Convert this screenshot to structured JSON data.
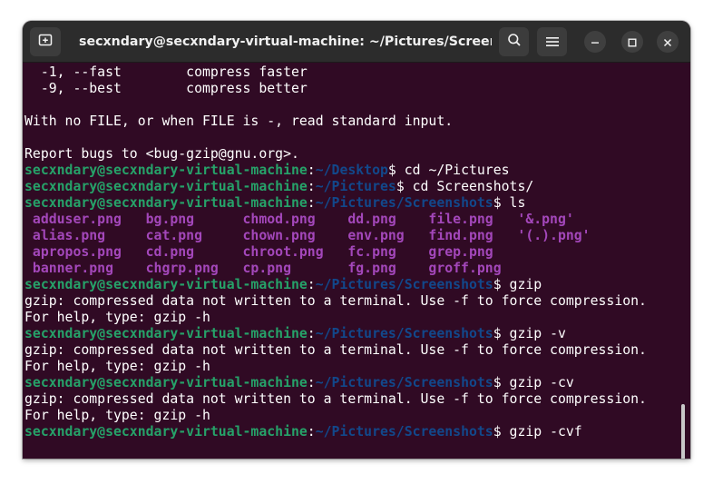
{
  "window": {
    "title": "secxndary@secxndary-virtual-machine: ~/Pictures/Screensh..."
  },
  "icons": {
    "new_tab": "new-tab-icon",
    "search": "search-icon",
    "menu": "hamburger-menu-icon",
    "minimize": "minimize-icon",
    "maximize": "maximize-icon",
    "close": "close-icon"
  },
  "colors": {
    "background": "#300a24",
    "titlebar": "#2c2c2c",
    "user_host": "#26a269",
    "path": "#12488b",
    "image_files": "#a347ba",
    "text": "#ffffff"
  },
  "terminal": {
    "lines": [
      {
        "segments": [
          {
            "text": "  -1, --fast        compress faster",
            "cls": "w"
          }
        ]
      },
      {
        "segments": [
          {
            "text": "  -9, --best        compress better",
            "cls": "w"
          }
        ]
      },
      {
        "segments": [
          {
            "text": "",
            "cls": "w"
          }
        ]
      },
      {
        "segments": [
          {
            "text": "With no FILE, or when FILE is -, read standard input.",
            "cls": "w"
          }
        ]
      },
      {
        "segments": [
          {
            "text": "",
            "cls": "w"
          }
        ]
      },
      {
        "segments": [
          {
            "text": "Report bugs to <bug-gzip@gnu.org>.",
            "cls": "w"
          }
        ]
      },
      {
        "segments": [
          {
            "text": "secxndary@secxndary-virtual-machine",
            "cls": "g"
          },
          {
            "text": ":",
            "cls": "w"
          },
          {
            "text": "~/Desktop",
            "cls": "b"
          },
          {
            "text": "$ cd ~/Pictures",
            "cls": "w"
          }
        ]
      },
      {
        "segments": [
          {
            "text": "secxndary@secxndary-virtual-machine",
            "cls": "g"
          },
          {
            "text": ":",
            "cls": "w"
          },
          {
            "text": "~/Pictures",
            "cls": "b"
          },
          {
            "text": "$ cd Screenshots/",
            "cls": "w"
          }
        ]
      },
      {
        "segments": [
          {
            "text": "secxndary@secxndary-virtual-machine",
            "cls": "g"
          },
          {
            "text": ":",
            "cls": "w"
          },
          {
            "text": "~/Pictures/Screenshots",
            "cls": "b"
          },
          {
            "text": "$ ls",
            "cls": "w"
          }
        ]
      },
      {
        "segments": [
          {
            "text": " adduser.png   bg.png      chmod.png    dd.png    file.png   '&.png'",
            "cls": "m"
          }
        ]
      },
      {
        "segments": [
          {
            "text": " alias.png     cat.png     chown.png    env.png   find.png   '(.).png'",
            "cls": "m"
          }
        ]
      },
      {
        "segments": [
          {
            "text": " apropos.png   cd.png      chroot.png   fc.png    grep.png",
            "cls": "m"
          }
        ]
      },
      {
        "segments": [
          {
            "text": " banner.png    chgrp.png   cp.png       fg.png    groff.png",
            "cls": "m"
          }
        ]
      },
      {
        "segments": [
          {
            "text": "secxndary@secxndary-virtual-machine",
            "cls": "g"
          },
          {
            "text": ":",
            "cls": "w"
          },
          {
            "text": "~/Pictures/Screenshots",
            "cls": "b"
          },
          {
            "text": "$ gzip",
            "cls": "w"
          }
        ]
      },
      {
        "segments": [
          {
            "text": "gzip: compressed data not written to a terminal. Use -f to force compression.",
            "cls": "w"
          }
        ]
      },
      {
        "segments": [
          {
            "text": "For help, type: gzip -h",
            "cls": "w"
          }
        ]
      },
      {
        "segments": [
          {
            "text": "secxndary@secxndary-virtual-machine",
            "cls": "g"
          },
          {
            "text": ":",
            "cls": "w"
          },
          {
            "text": "~/Pictures/Screenshots",
            "cls": "b"
          },
          {
            "text": "$ gzip -v",
            "cls": "w"
          }
        ]
      },
      {
        "segments": [
          {
            "text": "gzip: compressed data not written to a terminal. Use -f to force compression.",
            "cls": "w"
          }
        ]
      },
      {
        "segments": [
          {
            "text": "For help, type: gzip -h",
            "cls": "w"
          }
        ]
      },
      {
        "segments": [
          {
            "text": "secxndary@secxndary-virtual-machine",
            "cls": "g"
          },
          {
            "text": ":",
            "cls": "w"
          },
          {
            "text": "~/Pictures/Screenshots",
            "cls": "b"
          },
          {
            "text": "$ gzip -cv",
            "cls": "w"
          }
        ]
      },
      {
        "segments": [
          {
            "text": "gzip: compressed data not written to a terminal. Use -f to force compression.",
            "cls": "w"
          }
        ]
      },
      {
        "segments": [
          {
            "text": "For help, type: gzip -h",
            "cls": "w"
          }
        ]
      },
      {
        "segments": [
          {
            "text": "secxndary@secxndary-virtual-machine",
            "cls": "g"
          },
          {
            "text": ":",
            "cls": "w"
          },
          {
            "text": "~/Pictures/Screenshots",
            "cls": "b"
          },
          {
            "text": "$ gzip -cvf",
            "cls": "w"
          }
        ]
      }
    ]
  }
}
